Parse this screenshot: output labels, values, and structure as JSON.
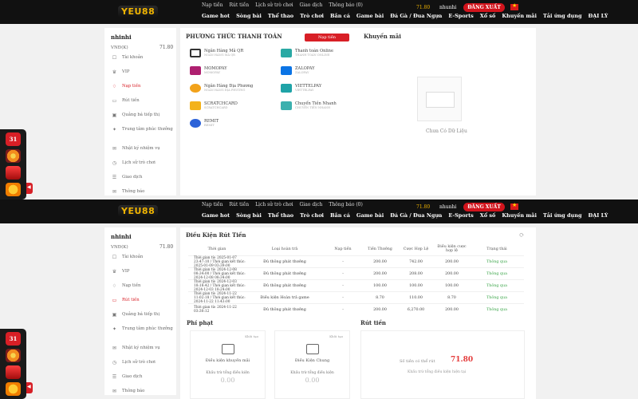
{
  "top": {
    "logo": "YEU88",
    "nav_top": [
      "Nạp tiền",
      "Rút tiền",
      "Lịch sử trò chơi",
      "Giao dịch",
      "Thông báo (0)"
    ],
    "nav_main": [
      "Game hot",
      "Sòng bài",
      "Thể thao",
      "Trò chơi",
      "Bắn cá",
      "Game bài",
      "Đá Gà / Đua Ngựa",
      "E-Sports",
      "Xổ số",
      "Khuyến mãi",
      "Tải ứng dụng",
      "ĐẠI LÝ"
    ],
    "balance": "71.80",
    "username": "nhunhi",
    "logout": "ĐĂNG XUẤT"
  },
  "sidebar": {
    "username": "nhinhi",
    "balance_label": "VNĐ(K)",
    "balance_value": "71.80",
    "items": [
      {
        "label": "Tài khoản",
        "icon": "account-icon"
      },
      {
        "label": "VIP",
        "icon": "vip-icon"
      },
      {
        "label": "Nạp tiền",
        "icon": "deposit-icon",
        "active": true
      },
      {
        "label": "Rút tiền",
        "icon": "withdraw-icon"
      },
      {
        "label": "Quảng bá tiếp thị",
        "icon": "promo-icon"
      },
      {
        "label": "Trung tâm phúc thưởng",
        "icon": "reward-icon"
      },
      {
        "label": "Nhật ký nhiệm vụ",
        "icon": "mission-icon"
      },
      {
        "label": "Lịch sử trò chơi",
        "icon": "history-icon"
      },
      {
        "label": "Giao dịch",
        "icon": "transaction-icon"
      },
      {
        "label": "Thông báo",
        "icon": "notice-icon"
      }
    ],
    "items2": [
      {
        "label": "Tài khoản",
        "icon": "account-icon"
      },
      {
        "label": "VIP",
        "icon": "vip-icon"
      },
      {
        "label": "Nạp tiền",
        "icon": "deposit-icon"
      },
      {
        "label": "Rút tiền",
        "icon": "withdraw-icon",
        "active": true
      },
      {
        "label": "Quảng bá tiếp thị",
        "icon": "promo-icon"
      },
      {
        "label": "Trung tâm phúc thưởng",
        "icon": "reward-icon"
      },
      {
        "label": "Nhật ký nhiệm vụ",
        "icon": "mission-icon"
      },
      {
        "label": "Lịch sử trò chơi",
        "icon": "history-icon"
      },
      {
        "label": "Giao dịch",
        "icon": "transaction-icon"
      },
      {
        "label": "Thông báo",
        "icon": "notice-icon"
      }
    ]
  },
  "deposit": {
    "section_title": "PHƯƠNG THỨC THANH TOÁN",
    "button": "Nạp tiền",
    "promo_title": "Khuyến mãi",
    "empty_text": "Chưa Có Dữ Liệu",
    "methods": [
      {
        "label": "Ngân Hàng Mã QR",
        "sub": "NGÂN HÀNG MÃ QR",
        "color": "#333"
      },
      {
        "label": "Thanh toán Online",
        "sub": "THANH TOÁN ONLINE",
        "color": "#2aa9a4"
      },
      {
        "label": "MOMOPAY",
        "sub": "MOMOPAY",
        "color": "#ae2070"
      },
      {
        "label": "ZALOPAY",
        "sub": "ZALOPAY",
        "color": "#0b74e5"
      },
      {
        "label": "Ngân Hàng Địa Phương",
        "sub": "NGÂN HÀNG ĐỊA PHƯƠNG",
        "color": "#f2a21a"
      },
      {
        "label": "VIETTELPAY",
        "sub": "VIETTELPAY",
        "color": "#1fa3a7"
      },
      {
        "label": "SCRATCHCARD",
        "sub": "SCRATCHCARD",
        "color": "#f3b21a"
      },
      {
        "label": "Chuyển Tiền Nhanh",
        "sub": "CHUYỂN TIỀN NHANH",
        "color": "#3bb0ae"
      },
      {
        "label": "REMIT",
        "sub": "REMIT",
        "color": "#2b62d8"
      }
    ]
  },
  "withdraw": {
    "title": "Điều Kiện Rút Tiền",
    "headers": [
      "Thời gian",
      "Loại hoàn trả",
      "Nạp tiền",
      "Tiền Thưởng",
      "Cược Hợp Lệ",
      "Điều kiện cược hợp lệ",
      "Trạng thái"
    ],
    "rows": [
      {
        "time": "Thời gian từ: 2025-01-07 23:47:10 / Thời gian kết thúc: 2025-01-09 03:39:00",
        "type": "Đủ thông phát thưởng",
        "deposit": "-",
        "bonus": "200.00",
        "bet": "742.00",
        "cond": "200.00",
        "status": "Thông qua"
      },
      {
        "time": "Thời gian từ: 2024-12-08 08:34:00 / Thời gian kết thúc: 2024-12-08 08:34:00",
        "type": "Đủ thông phát thưởng",
        "deposit": "-",
        "bonus": "200.00",
        "bet": "208.00",
        "cond": "200.00",
        "status": "Thông qua"
      },
      {
        "time": "Thời gian từ: 2024-12-03 18:18:42 / Thời gian kết thúc: 2024-12-03 18:24:00",
        "type": "Đủ thông phát thưởng",
        "deposit": "-",
        "bonus": "100.00",
        "bet": "100.00",
        "cond": "100.00",
        "status": "Thông qua"
      },
      {
        "time": "Thời gian từ: 2024-11-22 11:02:18 / Thời gian kết thúc: 2024-11-22 11:43:00",
        "type": "Điều kiện Hoàn trả game",
        "deposit": "-",
        "bonus": "8.70",
        "bet": "110.00",
        "cond": "8.70",
        "status": "Thông qua"
      },
      {
        "time": "Thời gian từ: 2024-11-22 03:30:12",
        "type": "Đủ thông phát thưởng",
        "deposit": "-",
        "bonus": "200.00",
        "bet": "6,270.00",
        "cond": "200.00",
        "status": "Thông qua"
      }
    ],
    "penalty_title": "Phí phạt",
    "withdraw_title": "Rút tiền",
    "cards": [
      {
        "tag": "Khôi tạo",
        "t1": "Điều kiện khuyến mãi",
        "t2": "Khấu trừ tổng điều kiện",
        "t3": "0.00"
      },
      {
        "tag": "Khôi tạo",
        "t1": "Điều Kiện Chung",
        "t2": "Khấu trừ tổng điều kiện",
        "t3": "0.00"
      }
    ],
    "balance_line": "Số tiền có thể rút",
    "balance_value": "71.80",
    "condition_line": "Khấu trừ tổng điều kiện hiện tại"
  }
}
